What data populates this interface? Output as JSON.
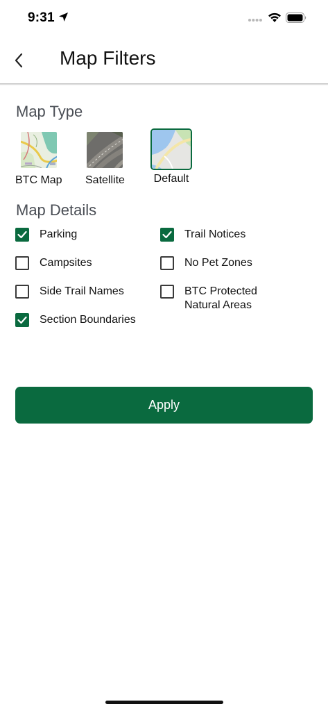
{
  "status_bar": {
    "time": "9:31"
  },
  "header": {
    "title": "Map Filters",
    "back_icon": "chevron-left-icon"
  },
  "map_type": {
    "title": "Map Type",
    "options": [
      {
        "label": "BTC Map",
        "selected": false
      },
      {
        "label": "Satellite",
        "selected": false
      },
      {
        "label": "Default",
        "selected": true
      }
    ]
  },
  "map_details": {
    "title": "Map Details",
    "items": [
      {
        "label": "Parking",
        "checked": true
      },
      {
        "label": "Campsites",
        "checked": false
      },
      {
        "label": "Side Trail Names",
        "checked": false
      },
      {
        "label": "Section Boundaries",
        "checked": true
      },
      {
        "label": "Trail Notices",
        "checked": true
      },
      {
        "label": "No Pet Zones",
        "checked": false
      },
      {
        "label": "BTC Protected\nNatural Areas",
        "checked": false
      }
    ]
  },
  "apply_label": "Apply",
  "colors": {
    "accent": "#0a6a3f",
    "section_title": "#4a4e55"
  }
}
